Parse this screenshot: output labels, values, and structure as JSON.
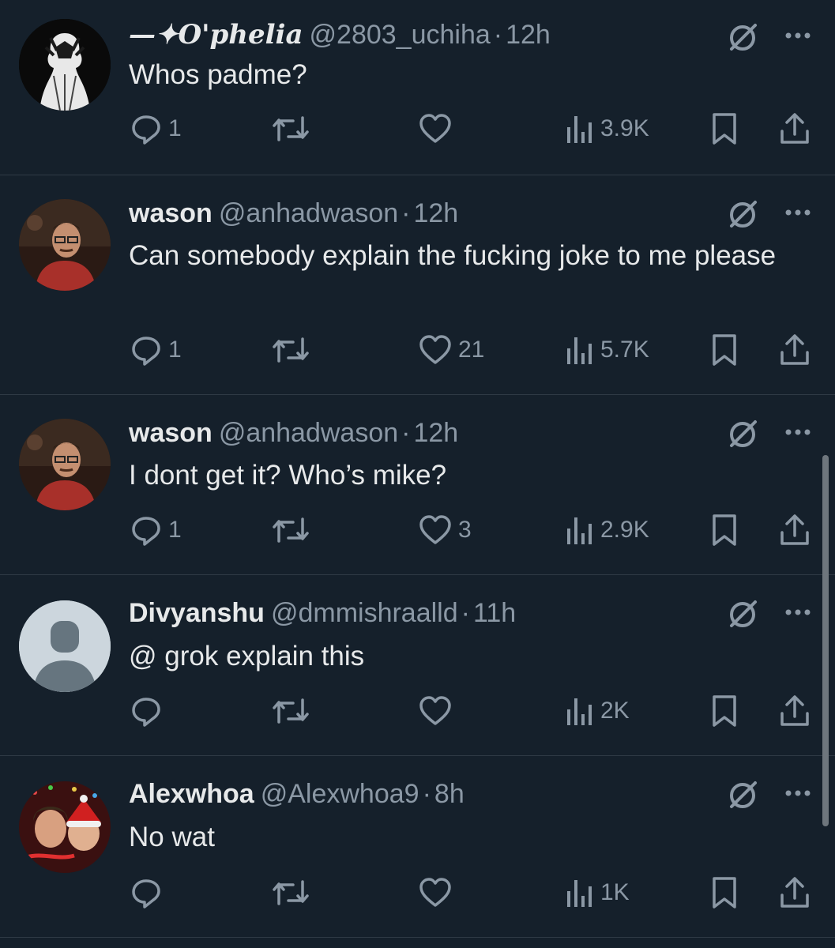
{
  "tweets": [
    {
      "display_name": "—✦O'phelia",
      "handle": "@2803_uchiha",
      "separator": "·",
      "time": "12h",
      "text": "Whos padme?",
      "replies": "1",
      "retweets": "",
      "likes": "",
      "views": "3.9K"
    },
    {
      "display_name": "wason",
      "handle": "@anhadwason",
      "separator": "·",
      "time": "12h",
      "text": "Can somebody explain the fucking joke to me please",
      "replies": "1",
      "retweets": "",
      "likes": "21",
      "views": "5.7K"
    },
    {
      "display_name": "wason",
      "handle": "@anhadwason",
      "separator": "·",
      "time": "12h",
      "text": "I dont get it? Who’s mike?",
      "replies": "1",
      "retweets": "",
      "likes": "3",
      "views": "2.9K"
    },
    {
      "display_name": "Divyanshu",
      "handle": "@dmmishraalld",
      "separator": "·",
      "time": "11h",
      "text": "@ grok explain this",
      "replies": "",
      "retweets": "",
      "likes": "",
      "views": "2K"
    },
    {
      "display_name": "Alexwhoa",
      "handle": "@Alexwhoa9",
      "separator": "·",
      "time": "8h",
      "text": "No wat",
      "replies": "",
      "retweets": "",
      "likes": "",
      "views": "1K"
    }
  ],
  "icons": {
    "reply": "reply-icon",
    "retweet": "retweet-icon",
    "like": "heart-icon",
    "views": "views-icon",
    "bookmark": "bookmark-icon",
    "share": "share-icon",
    "grok": "grok-icon",
    "more": "more-icon"
  },
  "colors": {
    "background": "#15202b",
    "text": "#e7e9ea",
    "secondary": "#8b98a5",
    "divider": "#2f3a45"
  }
}
